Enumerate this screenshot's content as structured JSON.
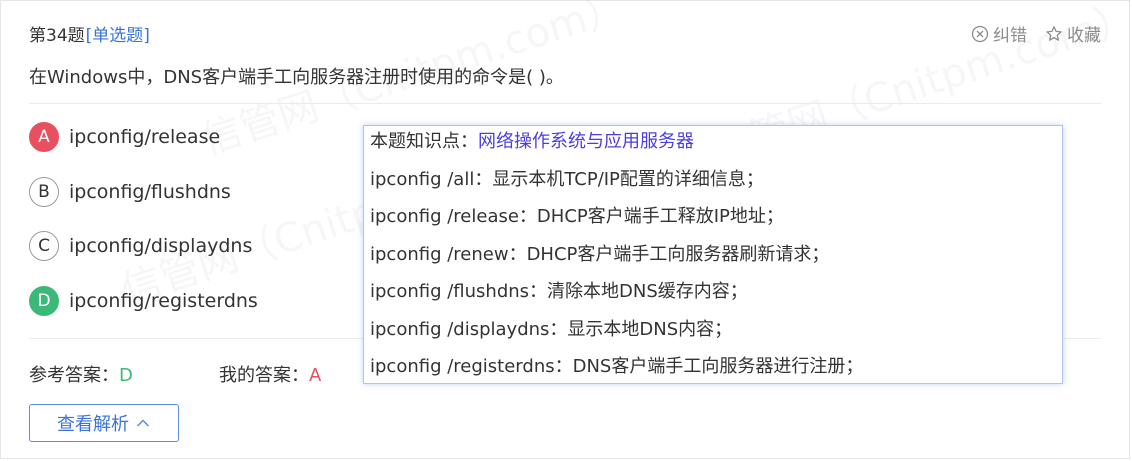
{
  "question": {
    "number": "第34题",
    "type": "[单选题]",
    "text": "在Windows中，DNS客户端手工向服务器注册时使用的命令是( )。"
  },
  "actions": {
    "report_label": "纠错",
    "favorite_label": "收藏"
  },
  "watermark": "信管网（Cnitpm.com）",
  "options": [
    {
      "letter": "A",
      "text": "ipconfig/release",
      "state": "wrong"
    },
    {
      "letter": "B",
      "text": "ipconfig/flushdns",
      "state": "normal"
    },
    {
      "letter": "C",
      "text": "ipconfig/displaydns",
      "state": "normal"
    },
    {
      "letter": "D",
      "text": "ipconfig/registerdns",
      "state": "correct"
    }
  ],
  "answers": {
    "reference_label": "参考答案：",
    "reference_value": "D",
    "mine_label": "我的答案：",
    "mine_value": "A"
  },
  "analysis_button": "查看解析",
  "popup": {
    "knowledge_label": "本题知识点：",
    "knowledge_link": "网络操作系统与应用服务器",
    "lines": [
      "ipconfig /all：显示本机TCP/IP配置的详细信息；",
      "ipconfig /release：DHCP客户端手工释放IP地址；",
      "ipconfig /renew：DHCP客户端手工向服务器刷新请求；",
      "ipconfig /flushdns：清除本地DNS缓存内容；",
      "ipconfig /displaydns：显示本地DNS内容；",
      "ipconfig /registerdns：DNS客户端手工向服务器进行注册；"
    ]
  },
  "colors": {
    "accent": "#3b73d9",
    "correct": "#3cb878",
    "wrong": "#e9505f",
    "link": "#4b3ee0"
  }
}
